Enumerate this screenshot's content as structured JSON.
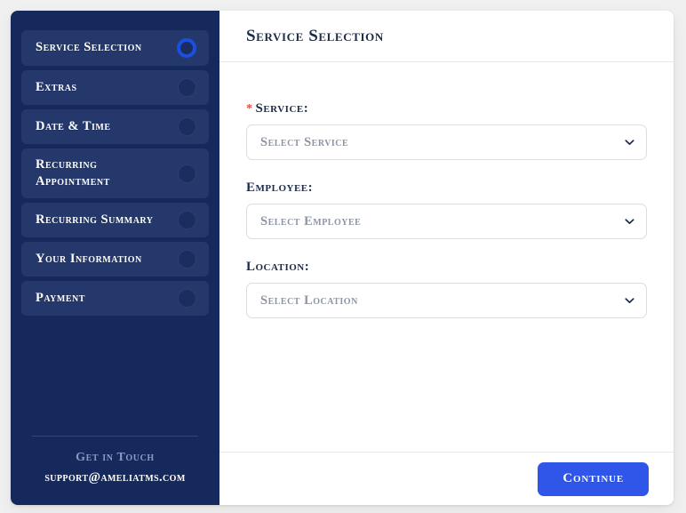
{
  "theme": {
    "page_background": "#f0f0f0",
    "sidebar_background": "#16295c",
    "sidebar_item_background": "#24386c",
    "accent_blue": "#2f56e8",
    "active_dot_blue": "#1a4fe0",
    "title_navy": "#1c2b4a",
    "placeholder_gray": "#8c94a3",
    "required_star_red": "#d8504a",
    "footer_heading_blue_gray": "#8b9bc4"
  },
  "sidebar": {
    "steps": [
      {
        "label": "Service Selection",
        "state": "active"
      },
      {
        "label": "Extras",
        "state": "inactive"
      },
      {
        "label": "Date & Time",
        "state": "inactive"
      },
      {
        "label": "Recurring Appointment",
        "state": "inactive"
      },
      {
        "label": "Recurring Summary",
        "state": "inactive"
      },
      {
        "label": "Your Information",
        "state": "inactive"
      },
      {
        "label": "Payment",
        "state": "inactive"
      }
    ],
    "footer": {
      "heading": "Get in Touch",
      "email": "support@ameliatms.com"
    }
  },
  "main": {
    "header": {
      "title": "Service Selection"
    },
    "fields": [
      {
        "label": "Service:",
        "required": true,
        "required_marker": "*",
        "placeholder": "Select Service",
        "value": "",
        "icon": "chevron-down-icon"
      },
      {
        "label": "Employee:",
        "required": false,
        "required_marker": "",
        "placeholder": "Select Employee",
        "value": "",
        "icon": "chevron-down-icon"
      },
      {
        "label": "Location:",
        "required": false,
        "required_marker": "",
        "placeholder": "Select Location",
        "value": "",
        "icon": "chevron-down-icon"
      }
    ],
    "footer": {
      "continue_label": "Continue"
    }
  }
}
